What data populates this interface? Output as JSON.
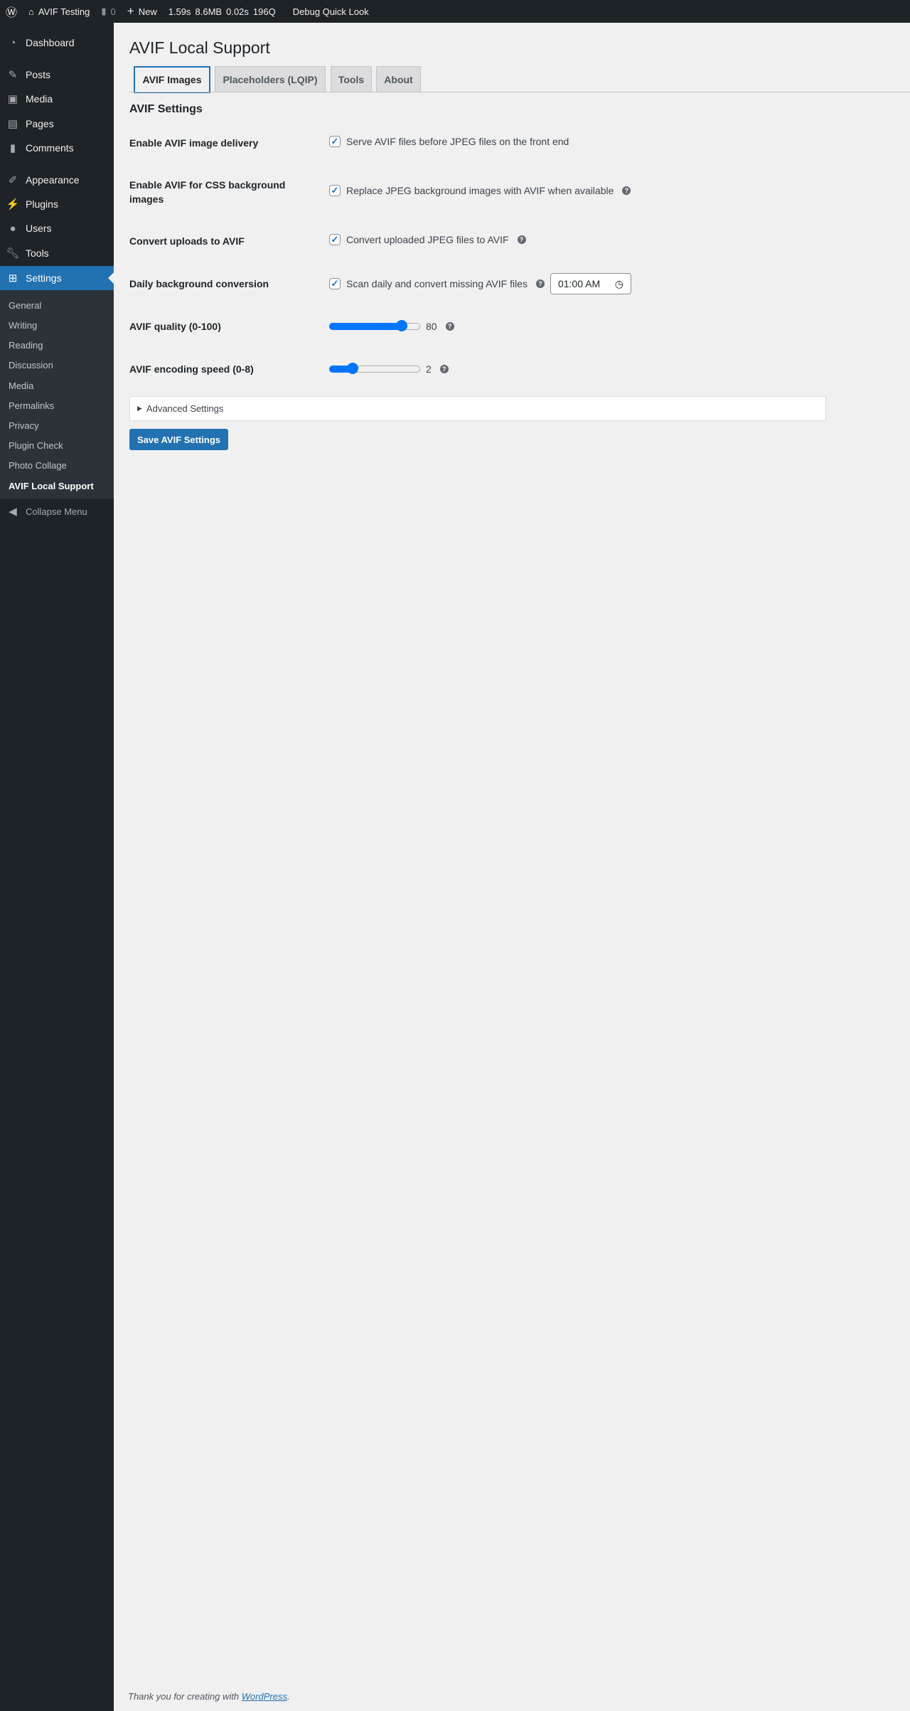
{
  "adminbar": {
    "site": "AVIF Testing",
    "comments": "0",
    "new": "New",
    "stats": {
      "time": "1.59s",
      "memory": "8.6MB",
      "db_time": "0.02s",
      "queries": "196Q"
    },
    "debug": "Debug Quick Look"
  },
  "sidebar": {
    "items": [
      {
        "label": "Dashboard",
        "icon": "dashboard-icon"
      },
      {
        "label": "Posts",
        "icon": "pin-icon"
      },
      {
        "label": "Media",
        "icon": "media-icon"
      },
      {
        "label": "Pages",
        "icon": "pages-icon"
      },
      {
        "label": "Comments",
        "icon": "comment-icon"
      },
      {
        "label": "Appearance",
        "icon": "brush-icon"
      },
      {
        "label": "Plugins",
        "icon": "plugin-icon"
      },
      {
        "label": "Users",
        "icon": "user-icon"
      },
      {
        "label": "Tools",
        "icon": "wrench-icon"
      },
      {
        "label": "Settings",
        "icon": "settings-icon"
      }
    ],
    "submenu": [
      "General",
      "Writing",
      "Reading",
      "Discussion",
      "Media",
      "Permalinks",
      "Privacy",
      "Plugin Check",
      "Photo Collage",
      "AVIF Local Support"
    ],
    "collapse": "Collapse Menu"
  },
  "page": {
    "title": "AVIF Local Support",
    "tabs": [
      "AVIF Images",
      "Placeholders (LQIP)",
      "Tools",
      "About"
    ],
    "section": "AVIF Settings",
    "rows": [
      {
        "label": "Enable AVIF image delivery",
        "desc": "Serve AVIF files before JPEG files on the front end",
        "checked": true
      },
      {
        "label": "Enable AVIF for CSS background images",
        "desc": "Replace JPEG background images with AVIF when available",
        "checked": true
      },
      {
        "label": "Convert uploads to AVIF",
        "desc": "Convert uploaded JPEG files to AVIF",
        "checked": true
      },
      {
        "label": "Daily background conversion",
        "desc": "Scan daily and convert missing AVIF files",
        "checked": true,
        "time": "01:00 AM"
      }
    ],
    "quality": {
      "label": "AVIF quality (0-100)",
      "value": "80",
      "min": 0,
      "max": 100
    },
    "speed": {
      "label": "AVIF encoding speed (0-8)",
      "value": "2",
      "min": 0,
      "max": 8
    },
    "advanced": "Advanced Settings",
    "save": "Save AVIF Settings"
  },
  "footer": {
    "text": "Thank you for creating with ",
    "link": "WordPress",
    "end": "."
  }
}
